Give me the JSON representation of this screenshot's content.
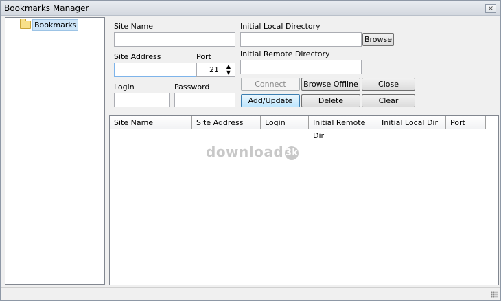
{
  "window": {
    "title": "Bookmarks Manager",
    "close_glyph": "×"
  },
  "tree": {
    "root_label": "Bookmarks",
    "root_icon": "folder-icon"
  },
  "form": {
    "site_name_label": "Site Name",
    "site_name_value": "",
    "site_address_label": "Site Address",
    "site_address_value": "",
    "port_label": "Port",
    "port_value": "21",
    "login_label": "Login",
    "login_value": "",
    "password_label": "Password",
    "password_value": "",
    "local_dir_label": "Initial Local Directory",
    "local_dir_value": "",
    "remote_dir_label": "Initial Remote Directory",
    "remote_dir_value": ""
  },
  "buttons": {
    "browse": "Browse",
    "connect": "Connect",
    "browse_offline": "Browse Offline",
    "close": "Close",
    "add_update": "Add/Update",
    "delete": "Delete",
    "clear": "Clear"
  },
  "grid": {
    "columns": [
      "Site Name",
      "Site Address",
      "Login",
      "Initial Remote Dir",
      "Initial Local Dir",
      "Port"
    ],
    "rows": []
  },
  "watermark": {
    "text": "download",
    "badge": "3k"
  },
  "colors": {
    "selection": "#cde4f7",
    "focus_border": "#7eb4ea"
  }
}
